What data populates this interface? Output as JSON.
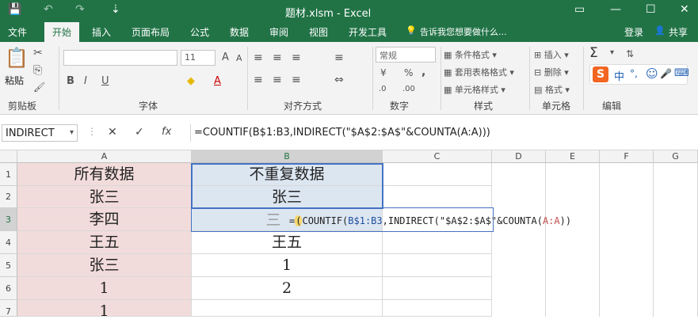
{
  "window": {
    "title": "题材.xlsm - Excel",
    "qat": {
      "save_icon": "💾",
      "undo_icon": "↶",
      "redo_icon": "↷",
      "custom_icon": "⇣"
    },
    "controls": {
      "ribbon_opt": "▭",
      "min": "—",
      "max": "☐",
      "close": "✕"
    }
  },
  "tabs": [
    "文件",
    "开始",
    "插入",
    "页面布局",
    "公式",
    "数据",
    "审阅",
    "视图",
    "开发工具"
  ],
  "tell_me": "告诉我您想要做什么...",
  "account": {
    "login": "登录",
    "share": "共享",
    "share_icon": "👤"
  },
  "ribbon": {
    "clipboard": {
      "paste": "粘贴",
      "paste_icon": "📋",
      "cut_icon": "✂",
      "copy_icon": "⎘",
      "format_icon": "🖌",
      "label": "剪贴板"
    },
    "font": {
      "name_placeholder": "",
      "size": "11",
      "grow": "A",
      "shrink": "A",
      "bold": "B",
      "italic": "I",
      "underline": "U",
      "fill_icon": "◆",
      "color_icon": "A",
      "label": "字体"
    },
    "alignment": {
      "label": "对齐方式",
      "wrap_icon": "≡",
      "merge_icon": "⇔"
    },
    "number": {
      "format": "常规",
      "percent": "%",
      "comma": ",",
      "currency": "¥",
      "inc": ".0",
      "dec": ".00",
      "label": "数字"
    },
    "styles": {
      "conditional": "条件格式",
      "table": "套用表格格式",
      "cell": "单元格样式",
      "label": "样式"
    },
    "cells": {
      "insert": "插入",
      "delete": "删除",
      "format": "格式",
      "label": "单元格"
    },
    "editing": {
      "sum_icon": "Σ",
      "fill_icon": "⬇",
      "clear_icon": "◇",
      "label": "编辑"
    },
    "ime": {
      "logo": "S",
      "mode": "中",
      "punct": "°,",
      "emoji": "☺",
      "mic": "🎤",
      "keyboard": "⌨"
    }
  },
  "formula_bar": {
    "name_box": "INDIRECT",
    "cancel": "✕",
    "enter": "✓",
    "fx": "fx",
    "formula": "=COUNTIF(B$1:B3,INDIRECT(\"$A$2:$A$\"&COUNTA(A:A)))"
  },
  "columns": [
    "A",
    "B",
    "C",
    "D",
    "E",
    "F",
    "G"
  ],
  "rows": [
    "1",
    "2",
    "3",
    "4",
    "5",
    "6",
    "7"
  ],
  "cells": {
    "A": [
      "所有数据",
      "张三",
      "李四",
      "王五",
      "张三",
      "1",
      "1"
    ],
    "B": [
      "不重复数据",
      "张三",
      "",
      "王五",
      "1",
      "2",
      ""
    ]
  },
  "edit_in_cell": {
    "overlap_fragment": "三",
    "eq": "=",
    "cursor_mark": "(",
    "fn1": "COUNTIF(",
    "ref1": "B$1:B3",
    "sep1": ",",
    "fn2": "INDIRECT(",
    "str": "\"$A$2:$A$\"",
    "concat": "&COUNTA(",
    "ref2": "A:A",
    "close": "))"
  }
}
